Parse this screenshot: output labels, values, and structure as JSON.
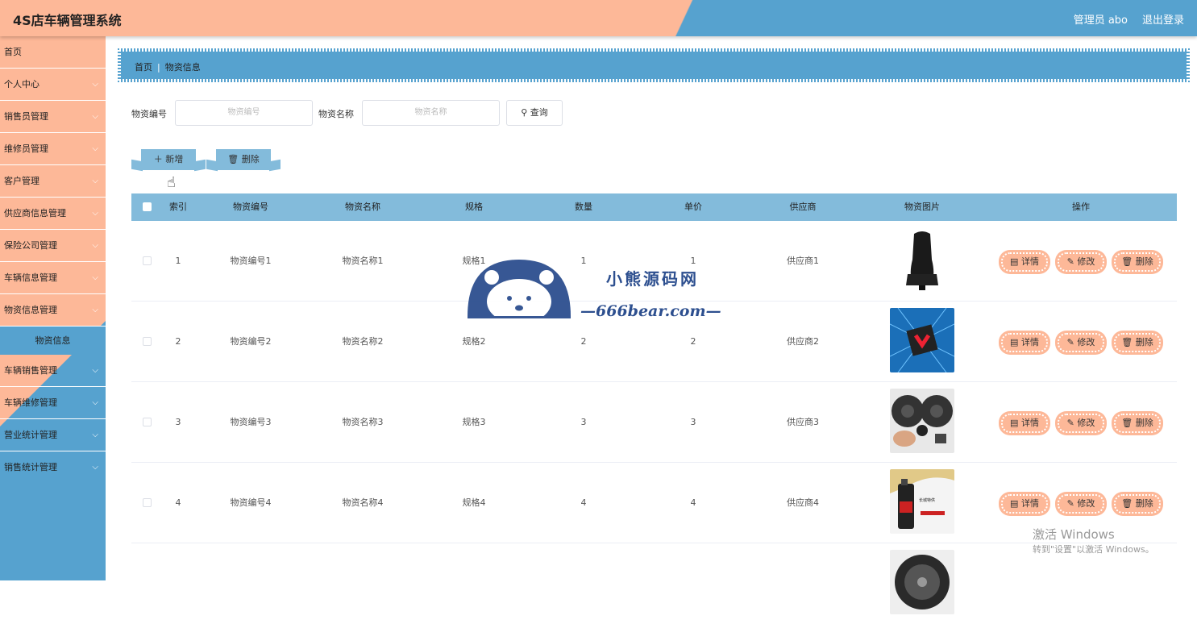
{
  "header": {
    "title": "4S店车辆管理系统",
    "admin": "管理员 abo",
    "logout": "退出登录"
  },
  "sidebar": {
    "items": [
      {
        "label": "首页",
        "has_chevron": false
      },
      {
        "label": "个人中心",
        "has_chevron": true
      },
      {
        "label": "销售员管理",
        "has_chevron": true
      },
      {
        "label": "维修员管理",
        "has_chevron": true
      },
      {
        "label": "客户管理",
        "has_chevron": true
      },
      {
        "label": "供应商信息管理",
        "has_chevron": true
      },
      {
        "label": "保险公司管理",
        "has_chevron": true
      },
      {
        "label": "车辆信息管理",
        "has_chevron": true
      },
      {
        "label": "物资信息管理",
        "has_chevron": true
      }
    ],
    "active_sub": "物资信息",
    "items_after": [
      {
        "label": "车辆销售管理"
      },
      {
        "label": "车辆维修管理"
      },
      {
        "label": "营业统计管理"
      },
      {
        "label": "销售统计管理"
      }
    ]
  },
  "breadcrumb": {
    "home": "首页",
    "current": "物资信息"
  },
  "search": {
    "code_label": "物资编号",
    "code_placeholder": "物资编号",
    "name_label": "物资名称",
    "name_placeholder": "物资名称",
    "query_label": "查询"
  },
  "actions": {
    "add": "新增",
    "delete": "删除"
  },
  "table": {
    "headers": [
      "索引",
      "物资编号",
      "物资名称",
      "规格",
      "数量",
      "单价",
      "供应商",
      "物资图片",
      "操作"
    ],
    "rows": [
      {
        "index": "1",
        "code": "物资编号1",
        "name": "物资名称1",
        "spec": "规格1",
        "qty": "1",
        "price": "1",
        "supplier": "供应商1"
      },
      {
        "index": "2",
        "code": "物资编号2",
        "name": "物资名称2",
        "spec": "规格2",
        "qty": "2",
        "price": "2",
        "supplier": "供应商2"
      },
      {
        "index": "3",
        "code": "物资编号3",
        "name": "物资名称3",
        "spec": "规格3",
        "qty": "3",
        "price": "3",
        "supplier": "供应商3"
      },
      {
        "index": "4",
        "code": "物资编号4",
        "name": "物资名称4",
        "spec": "规格4",
        "qty": "4",
        "price": "4",
        "supplier": "供应商4"
      }
    ],
    "op_labels": {
      "detail": "详情",
      "edit": "修改",
      "delete": "删除"
    }
  },
  "watermark": {
    "line1": "小熊源码网",
    "line2": "—666bear.com—"
  },
  "windows_activation": {
    "line1": "激活 Windows",
    "line2": "转到\"设置\"以激活 Windows。"
  },
  "colors": {
    "peach": "#fdb898",
    "blue": "#56a2cf",
    "table_head": "#83bbdb"
  }
}
